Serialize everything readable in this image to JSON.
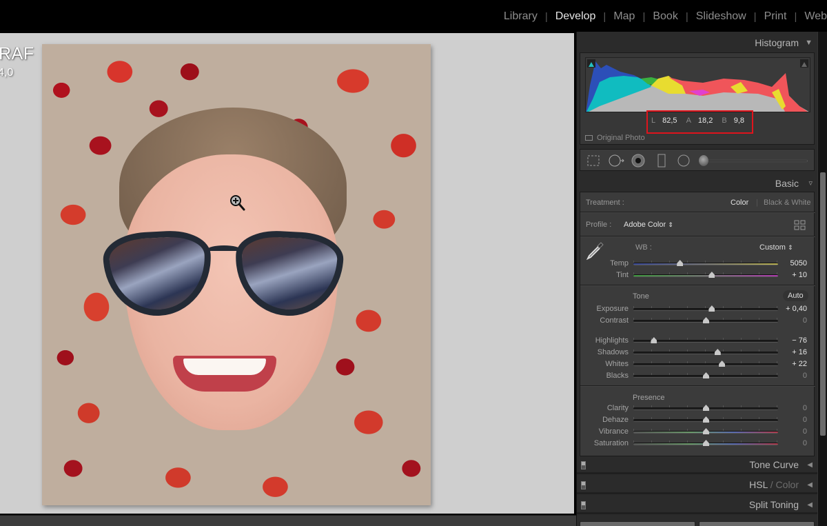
{
  "modules": [
    {
      "label": "Library",
      "active": false
    },
    {
      "label": "Develop",
      "active": true
    },
    {
      "label": "Map",
      "active": false
    },
    {
      "label": "Book",
      "active": false
    },
    {
      "label": "Slideshow",
      "active": false
    },
    {
      "label": "Print",
      "active": false
    },
    {
      "label": "Web",
      "active": false
    }
  ],
  "module_separator": "|",
  "workspace": {
    "filename_fragment": "RAF",
    "fileinfo_fragment": "4,0",
    "cursor_icon": "zoom-in-cursor"
  },
  "histogram": {
    "title": "Histogram",
    "collapse_icon": "triangle-down",
    "readout": {
      "L_key": "L",
      "L_val": "82,5",
      "A_key": "A",
      "A_val": "18,2",
      "B_key": "B",
      "B_val": "9,8"
    },
    "original_photo_label": "Original Photo",
    "highlight_box_color": "#e0141c"
  },
  "tools": [
    "crop-overlay",
    "spot-removal",
    "red-eye",
    "graduated-filter",
    "radial-filter",
    "adjustment-brush"
  ],
  "basic": {
    "title": "Basic",
    "treatment_label": "Treatment :",
    "treatment_options": [
      "Color",
      "Black & White"
    ],
    "treatment_selected": "Color",
    "profile_label": "Profile :",
    "profile_value": "Adobe Color",
    "profile_chevron": "⇕",
    "wb_label": "WB :",
    "wb_value": "Custom",
    "wb_chevron": "⇕",
    "wb_sliders": [
      {
        "name": "Temp",
        "value": "5050",
        "pos": 0.32
      },
      {
        "name": "Tint",
        "value": "+ 10",
        "pos": 0.54
      }
    ],
    "tone_title": "Tone",
    "auto_label": "Auto",
    "tone_sliders_a": [
      {
        "name": "Exposure",
        "value": "+ 0,40",
        "pos": 0.54
      },
      {
        "name": "Contrast",
        "value": "0",
        "pos": 0.5
      }
    ],
    "tone_sliders_b": [
      {
        "name": "Highlights",
        "value": "− 76",
        "pos": 0.14
      },
      {
        "name": "Shadows",
        "value": "+ 16",
        "pos": 0.58
      },
      {
        "name": "Whites",
        "value": "+ 22",
        "pos": 0.61
      },
      {
        "name": "Blacks",
        "value": "0",
        "pos": 0.5
      }
    ],
    "presence_title": "Presence",
    "presence_sliders": [
      {
        "name": "Clarity",
        "value": "0",
        "pos": 0.5
      },
      {
        "name": "Dehaze",
        "value": "0",
        "pos": 0.5
      },
      {
        "name": "Vibrance",
        "value": "0",
        "pos": 0.5
      },
      {
        "name": "Saturation",
        "value": "0",
        "pos": 0.5
      }
    ]
  },
  "collapsed_panels": [
    {
      "label": "Tone Curve",
      "dim": ""
    },
    {
      "label": "HSL",
      "dim": " / Color"
    },
    {
      "label": "Split Toning",
      "dim": ""
    }
  ]
}
